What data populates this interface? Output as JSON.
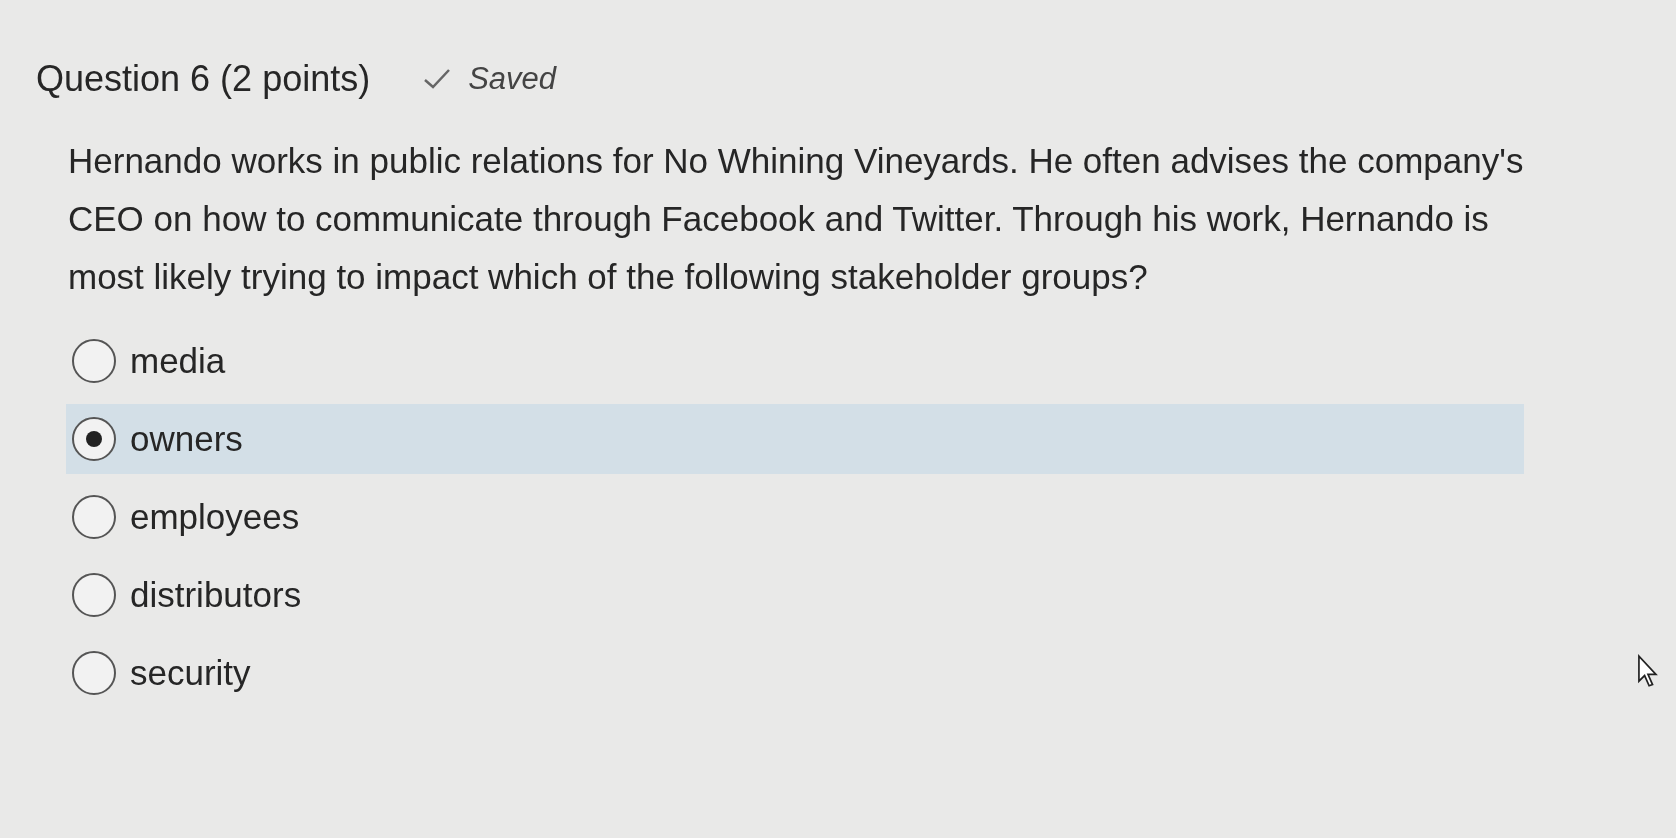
{
  "question": {
    "title": "Question 6 (2 points)",
    "status": "Saved",
    "text": "Hernando works in public relations for No Whining Vineyards. He often advises the company's CEO on how to communicate through Facebook and Twitter. Through his work, Hernando is most likely trying to impact which of the following stakeholder groups?"
  },
  "options": [
    {
      "label": "media",
      "selected": false
    },
    {
      "label": "owners",
      "selected": true
    },
    {
      "label": "employees",
      "selected": false
    },
    {
      "label": "distributors",
      "selected": false
    },
    {
      "label": "security",
      "selected": false
    }
  ]
}
